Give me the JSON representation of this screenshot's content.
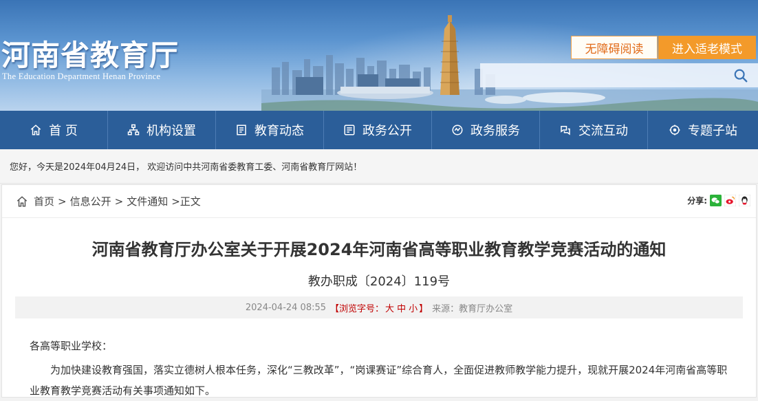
{
  "header": {
    "logo_cn": "河南省教育厅",
    "logo_en": "The Education Department Henan Province",
    "accessibility_label": "无障碍阅读",
    "elder_mode_label": "进入适老模式",
    "search_placeholder": ""
  },
  "nav": {
    "items": [
      {
        "label": "首 页",
        "icon": "home-icon"
      },
      {
        "label": "机构设置",
        "icon": "org-icon"
      },
      {
        "label": "教育动态",
        "icon": "news-icon"
      },
      {
        "label": "政务公开",
        "icon": "gov-open-icon"
      },
      {
        "label": "政务服务",
        "icon": "service-icon"
      },
      {
        "label": "交流互动",
        "icon": "interact-icon"
      },
      {
        "label": "专题子站",
        "icon": "topic-icon"
      }
    ]
  },
  "welcome": {
    "text": "您好，今天是2024年04月24日， 欢迎访问中共河南省委教育工委、河南省教育厅网站！"
  },
  "breadcrumb": {
    "items": [
      "首页",
      "信息公开",
      "文件通知"
    ],
    "separator": ">",
    "current": ">正文"
  },
  "share": {
    "label": "分享:",
    "icons": [
      "wechat-icon",
      "weibo-icon",
      "qq-icon"
    ]
  },
  "article": {
    "title": "河南省教育厅办公室关于开展2024年河南省高等职业教育教学竞赛活动的通知",
    "doc_number": "教办职成〔2024〕119号",
    "date": "2024-04-24 08:55",
    "font_size_prefix": "【浏览字号：",
    "font_size_large": "大",
    "font_size_medium": "中",
    "font_size_small": "小",
    "font_size_suffix": "】",
    "source": "来源：教育厅办公室",
    "salutation": "各高等职业学校：",
    "paragraph1": "为加快建设教育强国，落实立德树人根本任务，深化“三教改革”，“岗课赛证”综合育人，全面促进教师教学能力提升，现就开展2024年河南省高等职业教育教学竞赛活动有关事项通知如下。"
  },
  "colors": {
    "nav_bg": "#2b5e99",
    "accent_orange": "#f39a2a",
    "font_size_red": "#c00000"
  }
}
